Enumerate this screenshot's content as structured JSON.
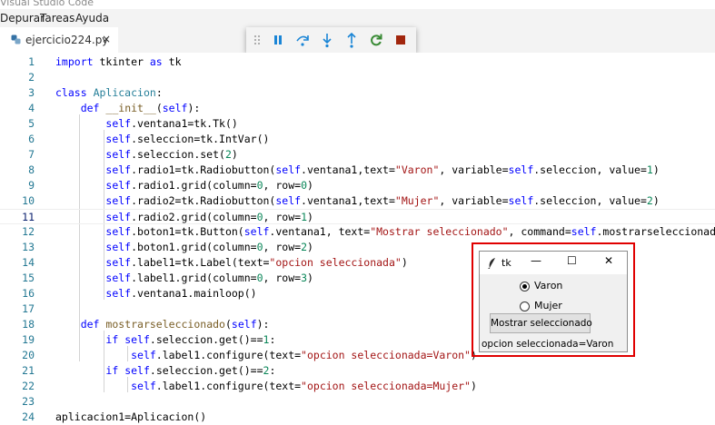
{
  "window": {
    "title": "Visual Studio Code"
  },
  "menu": [
    "Depurar",
    "Tareas",
    "Ayuda"
  ],
  "tab": {
    "filename": "ejercicio224.py",
    "close": "×"
  },
  "debug_toolbar": {
    "buttons": [
      "pause",
      "step-over",
      "step-into",
      "step-out",
      "restart",
      "stop"
    ],
    "colors": {
      "action": "#1a85d6",
      "restart": "#388a34",
      "stop": "#a1260d"
    }
  },
  "editor": {
    "current_line": 11,
    "lines": [
      {
        "n": "1"
      },
      {
        "n": "2"
      },
      {
        "n": "3"
      },
      {
        "n": "4"
      },
      {
        "n": "5"
      },
      {
        "n": "6"
      },
      {
        "n": "7"
      },
      {
        "n": "8"
      },
      {
        "n": "9"
      },
      {
        "n": "10"
      },
      {
        "n": "11"
      },
      {
        "n": "12"
      },
      {
        "n": "13"
      },
      {
        "n": "14"
      },
      {
        "n": "15"
      },
      {
        "n": "16"
      },
      {
        "n": "17"
      },
      {
        "n": "18"
      },
      {
        "n": "19"
      },
      {
        "n": "20"
      },
      {
        "n": "21"
      },
      {
        "n": "22"
      },
      {
        "n": "23"
      },
      {
        "n": "24"
      }
    ],
    "code": [
      [
        [
          "kw",
          "import"
        ],
        [
          "t",
          " tkinter "
        ],
        [
          "kw",
          "as"
        ],
        [
          "t",
          " tk"
        ]
      ],
      [],
      [
        [
          "kw",
          "class"
        ],
        [
          "t",
          " "
        ],
        [
          "cls",
          "Aplicacion"
        ],
        [
          "t",
          ":"
        ]
      ],
      [
        [
          "t",
          "    "
        ],
        [
          "kw",
          "def"
        ],
        [
          "t",
          " "
        ],
        [
          "fn",
          "__init__"
        ],
        [
          "t",
          "("
        ],
        [
          "slf",
          "self"
        ],
        [
          "t",
          "):"
        ]
      ],
      [
        [
          "t",
          "        "
        ],
        [
          "slf",
          "self"
        ],
        [
          "t",
          ".ventana1=tk.Tk()"
        ]
      ],
      [
        [
          "t",
          "        "
        ],
        [
          "slf",
          "self"
        ],
        [
          "t",
          ".seleccion=tk.IntVar()"
        ]
      ],
      [
        [
          "t",
          "        "
        ],
        [
          "slf",
          "self"
        ],
        [
          "t",
          ".seleccion.set("
        ],
        [
          "num",
          "2"
        ],
        [
          "t",
          ")"
        ]
      ],
      [
        [
          "t",
          "        "
        ],
        [
          "slf",
          "self"
        ],
        [
          "t",
          ".radio1=tk.Radiobutton("
        ],
        [
          "slf",
          "self"
        ],
        [
          "t",
          ".ventana1,text="
        ],
        [
          "str",
          "\"Varon\""
        ],
        [
          "t",
          ", variable="
        ],
        [
          "slf",
          "self"
        ],
        [
          "t",
          ".seleccion, value="
        ],
        [
          "num",
          "1"
        ],
        [
          "t",
          ")"
        ]
      ],
      [
        [
          "t",
          "        "
        ],
        [
          "slf",
          "self"
        ],
        [
          "t",
          ".radio1.grid(column="
        ],
        [
          "num",
          "0"
        ],
        [
          "t",
          ", row="
        ],
        [
          "num",
          "0"
        ],
        [
          "t",
          ")"
        ]
      ],
      [
        [
          "t",
          "        "
        ],
        [
          "slf",
          "self"
        ],
        [
          "t",
          ".radio2=tk.Radiobutton("
        ],
        [
          "slf",
          "self"
        ],
        [
          "t",
          ".ventana1,text="
        ],
        [
          "str",
          "\"Mujer\""
        ],
        [
          "t",
          ", variable="
        ],
        [
          "slf",
          "self"
        ],
        [
          "t",
          ".seleccion, value="
        ],
        [
          "num",
          "2"
        ],
        [
          "t",
          ")"
        ]
      ],
      [
        [
          "t",
          "        "
        ],
        [
          "slf",
          "self"
        ],
        [
          "t",
          ".radio2.grid(column="
        ],
        [
          "num",
          "0"
        ],
        [
          "t",
          ", row="
        ],
        [
          "num",
          "1"
        ],
        [
          "t",
          ")"
        ]
      ],
      [
        [
          "t",
          "        "
        ],
        [
          "slf",
          "self"
        ],
        [
          "t",
          ".boton1=tk.Button("
        ],
        [
          "slf",
          "self"
        ],
        [
          "t",
          ".ventana1, text="
        ],
        [
          "str",
          "\"Mostrar seleccionado\""
        ],
        [
          "t",
          ", command="
        ],
        [
          "slf",
          "self"
        ],
        [
          "t",
          ".mostrarseleccionado)"
        ]
      ],
      [
        [
          "t",
          "        "
        ],
        [
          "slf",
          "self"
        ],
        [
          "t",
          ".boton1.grid(column="
        ],
        [
          "num",
          "0"
        ],
        [
          "t",
          ", row="
        ],
        [
          "num",
          "2"
        ],
        [
          "t",
          ")"
        ]
      ],
      [
        [
          "t",
          "        "
        ],
        [
          "slf",
          "self"
        ],
        [
          "t",
          ".label1=tk.Label(text="
        ],
        [
          "str",
          "\"opcion seleccionada\""
        ],
        [
          "t",
          ")"
        ]
      ],
      [
        [
          "t",
          "        "
        ],
        [
          "slf",
          "self"
        ],
        [
          "t",
          ".label1.grid(column="
        ],
        [
          "num",
          "0"
        ],
        [
          "t",
          ", row="
        ],
        [
          "num",
          "3"
        ],
        [
          "t",
          ")"
        ]
      ],
      [
        [
          "t",
          "        "
        ],
        [
          "slf",
          "self"
        ],
        [
          "t",
          ".ventana1.mainloop()"
        ]
      ],
      [],
      [
        [
          "t",
          "    "
        ],
        [
          "kw",
          "def"
        ],
        [
          "t",
          " "
        ],
        [
          "fn",
          "mostrarseleccionado"
        ],
        [
          "t",
          "("
        ],
        [
          "slf",
          "self"
        ],
        [
          "t",
          "):"
        ]
      ],
      [
        [
          "t",
          "        "
        ],
        [
          "kw",
          "if"
        ],
        [
          "t",
          " "
        ],
        [
          "slf",
          "self"
        ],
        [
          "t",
          ".seleccion.get()=="
        ],
        [
          "num",
          "1"
        ],
        [
          "t",
          ":"
        ]
      ],
      [
        [
          "t",
          "            "
        ],
        [
          "slf",
          "self"
        ],
        [
          "t",
          ".label1.configure(text="
        ],
        [
          "str",
          "\"opcion seleccionada=Varon\""
        ],
        [
          "t",
          ")"
        ]
      ],
      [
        [
          "t",
          "        "
        ],
        [
          "kw",
          "if"
        ],
        [
          "t",
          " "
        ],
        [
          "slf",
          "self"
        ],
        [
          "t",
          ".seleccion.get()=="
        ],
        [
          "num",
          "2"
        ],
        [
          "t",
          ":"
        ]
      ],
      [
        [
          "t",
          "            "
        ],
        [
          "slf",
          "self"
        ],
        [
          "t",
          ".label1.configure(text="
        ],
        [
          "str",
          "\"opcion seleccionada=Mujer\""
        ],
        [
          "t",
          ")"
        ]
      ],
      [],
      [
        [
          "t",
          "aplicacion1=Aplicacion()"
        ]
      ]
    ]
  },
  "tk_window": {
    "title": "tk",
    "controls": {
      "minimize": "—",
      "maximize": "☐",
      "close": "✕"
    },
    "radio1": {
      "label": "Varon",
      "checked": true
    },
    "radio2": {
      "label": "Mujer",
      "checked": false
    },
    "button": "Mostrar seleccionado",
    "label": "opcion seleccionada=Varon"
  }
}
